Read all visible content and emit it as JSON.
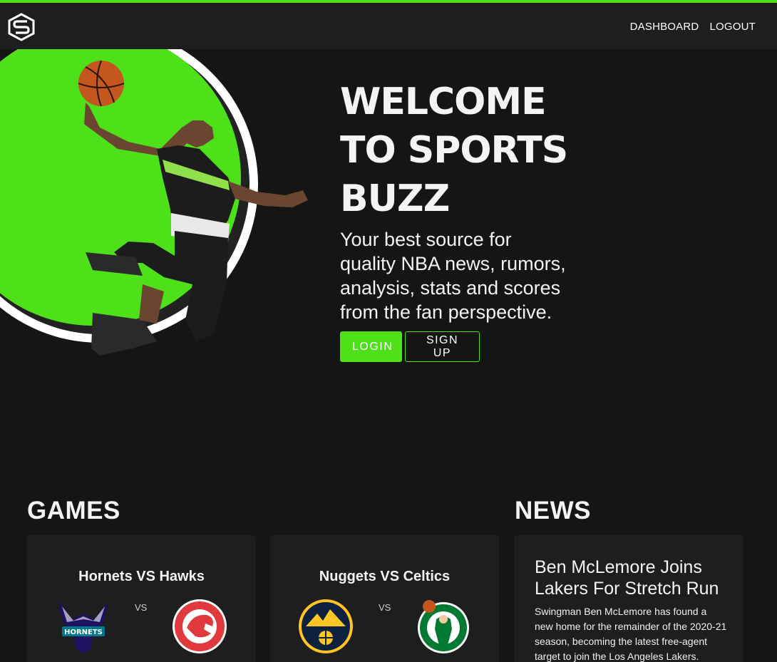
{
  "nav": {
    "logo": "sports-buzz-logo",
    "links": [
      "DASHBOARD",
      "LOGOUT"
    ]
  },
  "hero": {
    "title": "WELCOME TO SPORTS BUZZ",
    "subtitle": "Your best source for quality NBA news, rumors, analysis, stats and scores from the fan perspective.",
    "login_label": "LOGIN",
    "signup_label": "SIGN UP"
  },
  "games": {
    "heading": "GAMES",
    "items": [
      {
        "title": "Hornets VS Hawks",
        "vs": "VS",
        "home_logo": "charlotte-hornets-logo",
        "away_logo": "atlanta-hawks-logo"
      },
      {
        "title": "Nuggets VS Celtics",
        "vs": "VS",
        "home_logo": "denver-nuggets-logo",
        "away_logo": "boston-celtics-logo"
      }
    ]
  },
  "news": {
    "heading": "NEWS",
    "items": [
      {
        "title": "Ben McLemore Joins Lakers For Stretch Run",
        "body": "Swingman Ben McLemore has found a new home for the remainder of the 2020-21 season, becoming the latest free-agent target to join the Los Angeles Lakers."
      }
    ]
  },
  "colors": {
    "accent": "#4ee11a",
    "background": "#151515",
    "surface": "#1e1e1e",
    "text": "#f4f4f4"
  }
}
